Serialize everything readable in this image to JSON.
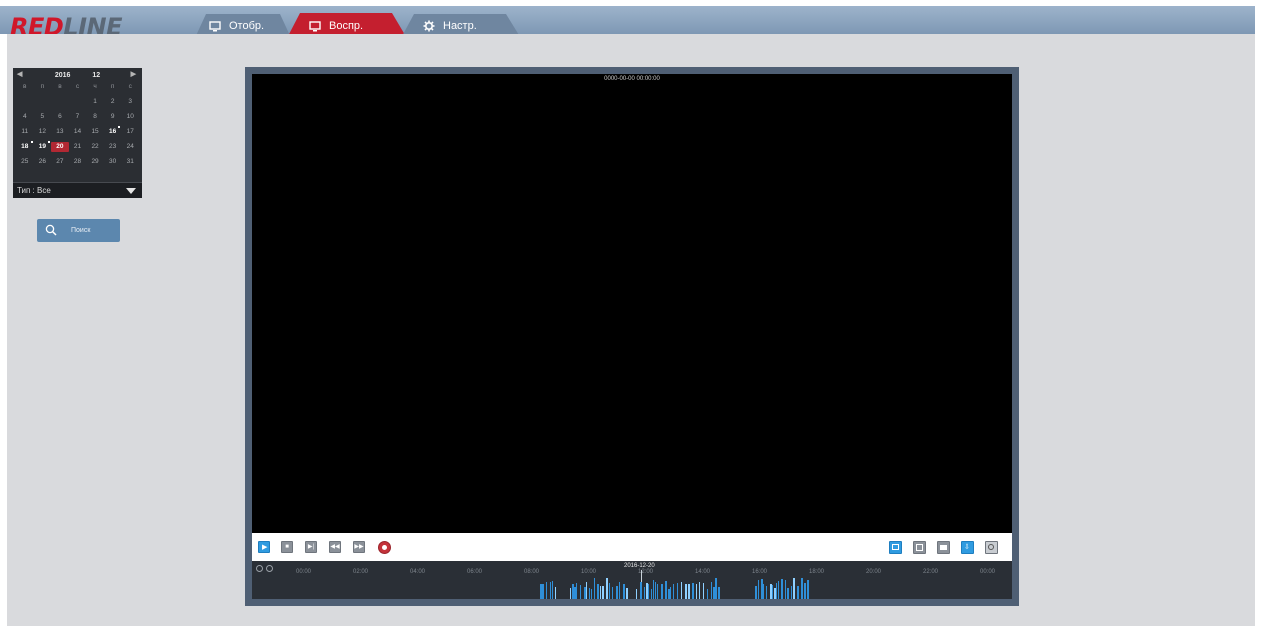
{
  "logo": {
    "part1": "RED",
    "part2": "LINE"
  },
  "tabs": [
    {
      "label": "Отобр.",
      "icon": "monitor-icon",
      "active": false
    },
    {
      "label": "Воспр.",
      "icon": "monitor-icon",
      "active": true
    },
    {
      "label": "Настр.",
      "icon": "gear-icon",
      "active": false
    }
  ],
  "calendar": {
    "year": "2016",
    "month": "12",
    "weekdays": [
      "в",
      "п",
      "в",
      "с",
      "ч",
      "п",
      "с"
    ],
    "weeks": [
      [
        "",
        "",
        "",
        "",
        "1",
        "2",
        "3"
      ],
      [
        "4",
        "5",
        "6",
        "7",
        "8",
        "9",
        "10"
      ],
      [
        "11",
        "12",
        "13",
        "14",
        "15",
        "16",
        "17"
      ],
      [
        "18",
        "19",
        "20",
        "21",
        "22",
        "23",
        "24"
      ],
      [
        "25",
        "26",
        "27",
        "28",
        "29",
        "30",
        "31"
      ]
    ],
    "recorded_days": [
      "16",
      "18",
      "19"
    ],
    "selected_day": "20",
    "type_label": "Тип : Все"
  },
  "search": {
    "label": "Поиск",
    "icon": "search-icon"
  },
  "video": {
    "timestamp": "0000-00-00 00:00:00"
  },
  "controls": {
    "left": [
      {
        "name": "play-button",
        "icon": "play-icon",
        "style": "blue"
      },
      {
        "name": "stop-button",
        "icon": "stop-icon",
        "style": "gray"
      },
      {
        "name": "step-forward-button",
        "icon": "step-icon",
        "style": "gray"
      },
      {
        "name": "slow-button",
        "icon": "rewind-icon",
        "style": "gray"
      },
      {
        "name": "fast-forward-button",
        "icon": "fast-forward-icon",
        "style": "gray"
      },
      {
        "name": "record-button",
        "icon": "record-icon",
        "style": "red"
      }
    ],
    "right": [
      {
        "name": "layout-single-button",
        "icon": "single-view-icon",
        "style": "blue"
      },
      {
        "name": "layout-quad-button",
        "icon": "quad-view-icon",
        "style": "gray"
      },
      {
        "name": "snapshot-button",
        "icon": "camera-icon",
        "style": "gray"
      },
      {
        "name": "download-button",
        "icon": "download-icon",
        "style": "blue"
      },
      {
        "name": "zoom-button",
        "icon": "zoom-icon",
        "style": "gray"
      }
    ]
  },
  "timeline": {
    "date": "2016-12-20",
    "labels": [
      "00:00",
      "02:00",
      "04:00",
      "06:00",
      "08:00",
      "10:00",
      "12:00",
      "14:00",
      "16:00",
      "18:00",
      "20:00",
      "22:00",
      "00:00"
    ],
    "record_color": "#2f8fd8"
  },
  "colors": {
    "accent_red": "#b22833",
    "accent_blue": "#2f9be0",
    "topbar": "#8aa2bd"
  }
}
